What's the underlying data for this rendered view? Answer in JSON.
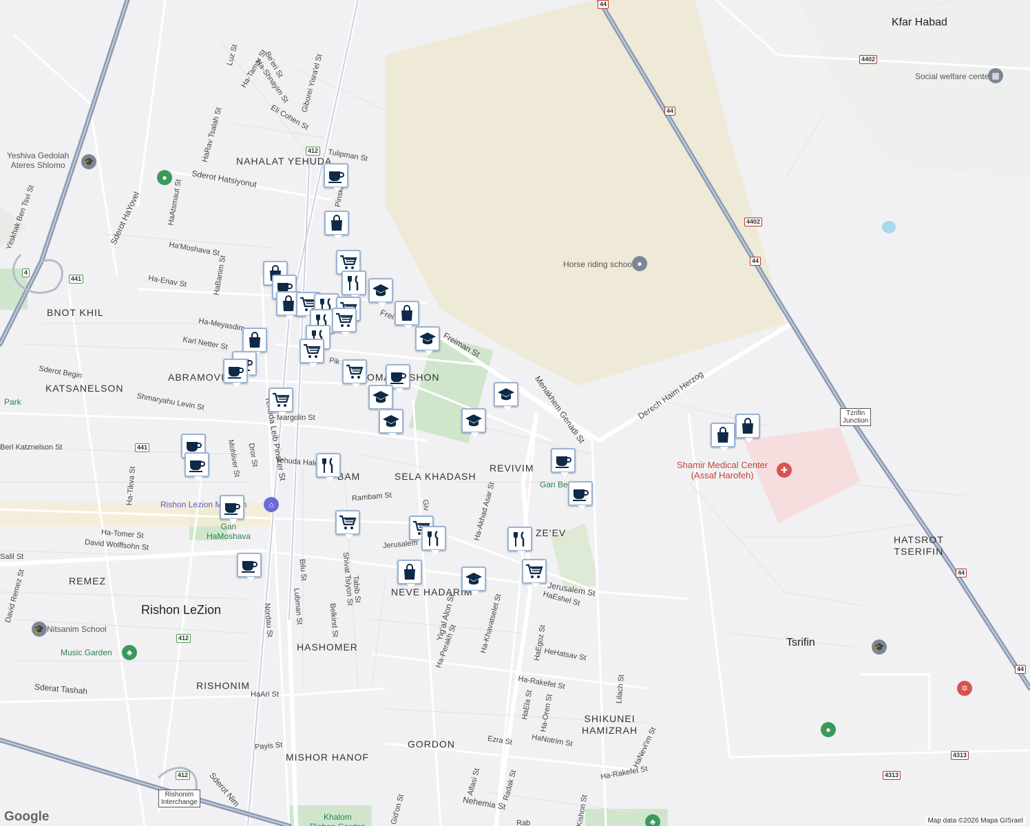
{
  "map": {
    "neighborhoods": [
      {
        "label": "NAHALAT\nYEHUDA"
      },
      {
        "label": "BNOT KHIL"
      },
      {
        "label": "ABRAMOVI"
      },
      {
        "label": "KATSANELSON"
      },
      {
        "label": "OMAN"
      },
      {
        "label": "SHON"
      },
      {
        "label": "SELA KHADASH"
      },
      {
        "label": "REVIVIM"
      },
      {
        "label": "BAM"
      },
      {
        "label": "ZE'EV"
      },
      {
        "label": "REMEZ"
      },
      {
        "label": "NEVE HADARIM"
      },
      {
        "label": "HASHOMER"
      },
      {
        "label": "RISHONIM"
      },
      {
        "label": "SHIKUNEI\nHAMIZRAH"
      },
      {
        "label": "GORDON"
      },
      {
        "label": "MISHOR HANOF"
      },
      {
        "label": "HATSROT\nTSERIFIN"
      }
    ],
    "cities": [
      {
        "label": "Rishon LeZion"
      },
      {
        "label": "Tsrifin"
      },
      {
        "label": "Kfar Habad"
      }
    ],
    "streets": [
      {
        "label": "Luz St"
      },
      {
        "label": "Ha-Tamar St"
      },
      {
        "label": "Be'eri St"
      },
      {
        "label": "Ha-Shnayim St"
      },
      {
        "label": "Giborei Yisra'el St"
      },
      {
        "label": "Eli Cohen St"
      },
      {
        "label": "HaRav Tsalah St"
      },
      {
        "label": "Tulipman St"
      },
      {
        "label": "Sderot Hatsiyonut"
      },
      {
        "label": "HaAtsmaut St"
      },
      {
        "label": "Sderot HaYovel"
      },
      {
        "label": "Yitskhak Ben Tsvi St"
      },
      {
        "label": "Ha'Moshava St"
      },
      {
        "label": "Ha-Enav St"
      },
      {
        "label": "HaBanim St"
      },
      {
        "label": "Ha-Meyasdim"
      },
      {
        "label": "Karl Netter St"
      },
      {
        "label": "Sderot Begin"
      },
      {
        "label": "Shmaryahu Levin St"
      },
      {
        "label": "Berl Katznelson St"
      },
      {
        "label": "Margolin St"
      },
      {
        "label": "Yehuda Leib Pinsker St"
      },
      {
        "label": "Mohliver St"
      },
      {
        "label": "Dror St"
      },
      {
        "label": "Yehuda Hale"
      },
      {
        "label": "Rambam St"
      },
      {
        "label": "Ha-Tikva St"
      },
      {
        "label": "Ha-Tomer St"
      },
      {
        "label": "David Wolffsohn St"
      },
      {
        "label": "Salil St"
      },
      {
        "label": "David Remez St"
      },
      {
        "label": "Jerusalem"
      },
      {
        "label": "Jerusalem St"
      },
      {
        "label": "Bilu St"
      },
      {
        "label": "Lubman St"
      },
      {
        "label": "Shivat Tsiyon St"
      },
      {
        "label": "Tabib St"
      },
      {
        "label": "Belkind St"
      },
      {
        "label": "Nordau St"
      },
      {
        "label": "Ha-Akhad Asar St"
      },
      {
        "label": "Yig'al Alon St"
      },
      {
        "label": "Ha-Perakh St"
      },
      {
        "label": "Ha-Khavatselet St"
      },
      {
        "label": "HaEshel St"
      },
      {
        "label": "HaEgoz St"
      },
      {
        "label": "HeHatsav St"
      },
      {
        "label": "Ha-Rakefet St"
      },
      {
        "label": "HaEla St"
      },
      {
        "label": "Ha-Oren St"
      },
      {
        "label": "Lilach St"
      },
      {
        "label": "Ezra St"
      },
      {
        "label": "HaNotrim St"
      },
      {
        "label": "HaNevi'im St"
      },
      {
        "label": "Ha-Rakefet St"
      },
      {
        "label": "Alfasi St"
      },
      {
        "label": "Radak St"
      },
      {
        "label": "Nehemia St"
      },
      {
        "label": "Gid'on St"
      },
      {
        "label": "Sderat Tashah"
      },
      {
        "label": "HaAri St"
      },
      {
        "label": "Payis St"
      },
      {
        "label": "Sderot Nim"
      },
      {
        "label": "Freiman St"
      },
      {
        "label": "Menakhem Genadi St"
      },
      {
        "label": "Derech Haim Herzog"
      },
      {
        "label": "Pinsker St"
      },
      {
        "label": "Frei"
      },
      {
        "label": "Pik"
      },
      {
        "label": "Giv"
      },
      {
        "label": "Kishon St"
      },
      {
        "label": "Rab"
      },
      {
        "label": "Gan Be"
      }
    ],
    "pois": [
      {
        "label": "Yeshiva Gedolah\nAteres Shlomo",
        "icon": "school-icon",
        "color": "#6b7785"
      },
      {
        "label": "Social welfare center",
        "icon": "building-icon",
        "color": "#6b7785"
      },
      {
        "label": "Horse riding school",
        "icon": "pin-icon",
        "color": "#6b7785"
      },
      {
        "label": "Shamir Medical Center\n(Assaf Harofeh)",
        "icon": "hospital-icon",
        "color": "#d9534f"
      },
      {
        "label": "Rishon Lezion Museum",
        "icon": "museum-icon",
        "color": "#6b6bd6"
      },
      {
        "label": "Gan\nHaMoshava",
        "icon": "park-icon",
        "color": "#3a9a5b"
      },
      {
        "label": "Nitsanim School",
        "icon": "school-icon",
        "color": "#6b7785"
      },
      {
        "label": "Music Garden",
        "icon": "tree-icon",
        "color": "#3a9a5b"
      },
      {
        "label": "Park",
        "icon": "park-icon",
        "color": "#3a9a5b"
      },
      {
        "label": "Khalom\nRishon Garden",
        "icon": "park-icon",
        "color": "#3a9a5b"
      }
    ],
    "shields": [
      {
        "label": "412",
        "type": "green"
      },
      {
        "label": "441",
        "type": "green"
      },
      {
        "label": "4",
        "type": "green"
      },
      {
        "label": "441",
        "type": "green"
      },
      {
        "label": "412",
        "type": "green"
      },
      {
        "label": "412",
        "type": "green"
      },
      {
        "label": "44",
        "type": "red"
      },
      {
        "label": "4402",
        "type": "red"
      },
      {
        "label": "4402",
        "type": "red"
      },
      {
        "label": "44",
        "type": "red"
      },
      {
        "label": "44",
        "type": "red"
      },
      {
        "label": "44",
        "type": "red"
      },
      {
        "label": "4313",
        "type": "red"
      },
      {
        "label": "4313",
        "type": "red"
      },
      {
        "label": "44",
        "type": "red"
      }
    ],
    "junctions": [
      {
        "label": "Tzrifin\nJunction"
      },
      {
        "label": "Rishonim\nInterchange"
      }
    ],
    "attribution": "Map data ©2026 Mapa GISrael",
    "logo": "Google"
  }
}
